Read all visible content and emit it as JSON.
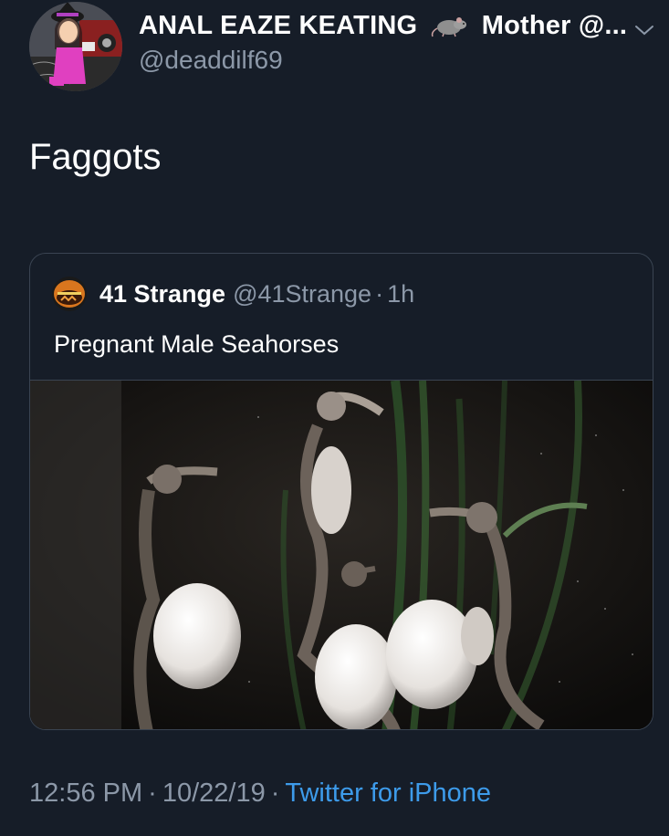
{
  "author": {
    "display_name": "ANAL EAZE KEATING",
    "display_name_suffix": "Mother @...",
    "emoji_icon": "rat-icon",
    "handle": "@deaddilf69"
  },
  "tweet": {
    "text": "Faggots"
  },
  "quoted_tweet": {
    "name": "41 Strange",
    "handle": "@41Strange",
    "time": "1h",
    "text": "Pregnant Male Seahorses",
    "media": "seahorses-photo"
  },
  "meta": {
    "time": "12:56 PM",
    "date": "10/22/19",
    "source": "Twitter for iPhone"
  },
  "colors": {
    "background": "#161d28",
    "secondary_text": "#8c98a8",
    "link": "#3d9bea",
    "border": "#3a4452"
  }
}
